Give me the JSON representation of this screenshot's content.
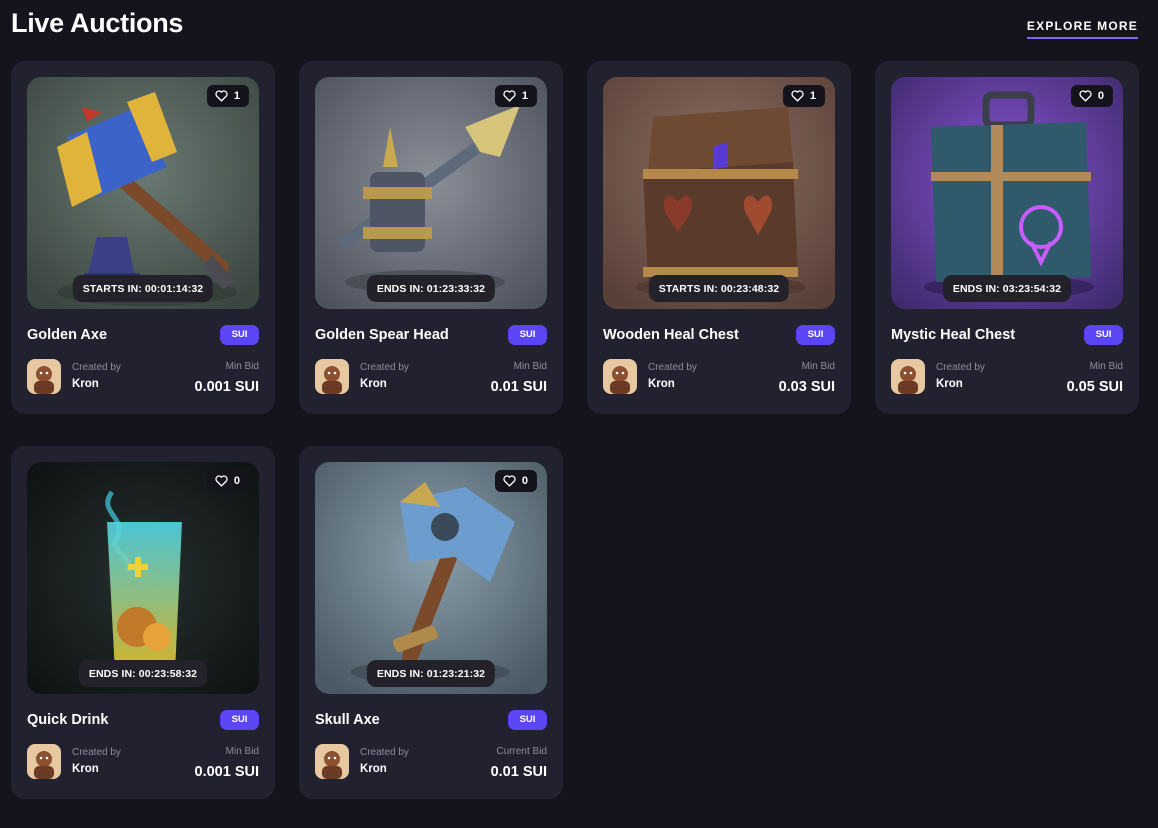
{
  "header": {
    "title": "Live Auctions",
    "explore_label": "EXPLORE MORE"
  },
  "auctions": [
    {
      "name": "Golden Axe",
      "likes": "1",
      "timer": "STARTS IN: 00:01:14:32",
      "chip": "SUI",
      "created_label": "Created by",
      "creator": "Kron",
      "bid_label": "Min Bid",
      "bid": "0.001 SUI"
    },
    {
      "name": "Golden Spear Head",
      "likes": "1",
      "timer": "ENDS IN: 01:23:33:32",
      "chip": "SUI",
      "created_label": "Created by",
      "creator": "Kron",
      "bid_label": "Min Bid",
      "bid": "0.01 SUI"
    },
    {
      "name": "Wooden Heal Chest",
      "likes": "1",
      "timer": "STARTS IN: 00:23:48:32",
      "chip": "SUI",
      "created_label": "Created by",
      "creator": "Kron",
      "bid_label": "Min Bid",
      "bid": "0.03 SUI"
    },
    {
      "name": "Mystic Heal Chest",
      "likes": "0",
      "timer": "ENDS IN: 03:23:54:32",
      "chip": "SUI",
      "created_label": "Created by",
      "creator": "Kron",
      "bid_label": "Min Bid",
      "bid": "0.05 SUI"
    },
    {
      "name": "Quick Drink",
      "likes": "0",
      "timer": "ENDS IN: 00:23:58:32",
      "chip": "SUI",
      "created_label": "Created by",
      "creator": "Kron",
      "bid_label": "Min Bid",
      "bid": "0.001 SUI"
    },
    {
      "name": "Skull Axe",
      "likes": "0",
      "timer": "ENDS IN: 01:23:21:32",
      "chip": "SUI",
      "created_label": "Created by",
      "creator": "Kron",
      "bid_label": "Current Bid",
      "bid": "0.01 SUI"
    }
  ],
  "colors": {
    "background": "#15141c",
    "card": "#222130",
    "accent": "#5b47f5",
    "underline": "#7c68f5"
  },
  "icons": {
    "likes": "heart-outline-icon"
  }
}
